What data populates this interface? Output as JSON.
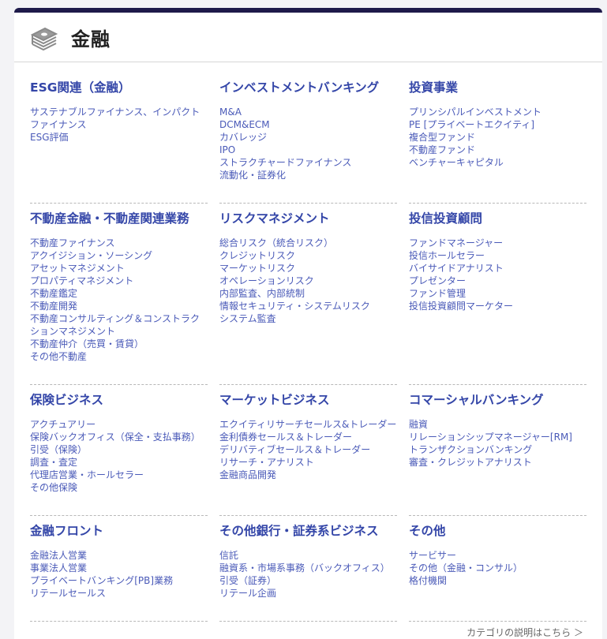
{
  "header": {
    "title": "金融"
  },
  "sections": [
    {
      "title": "ESG関連（金融）",
      "items": [
        "サステナブルファイナンス、インパクトファイナンス",
        "ESG評価"
      ]
    },
    {
      "title": "インベストメントバンキング",
      "items": [
        "M&A",
        "DCM&ECM",
        "カバレッジ",
        "IPO",
        "ストラクチャードファイナンス",
        "流動化・証券化"
      ]
    },
    {
      "title": "投資事業",
      "items": [
        "プリンシパルインベストメント",
        "PE [プライベートエクイティ]",
        "複合型ファンド",
        "不動産ファンド",
        "ベンチャーキャピタル"
      ]
    },
    {
      "title": "不動産金融・不動産関連業務",
      "items": [
        "不動産ファイナンス",
        "アクイジション・ソーシング",
        "アセットマネジメント",
        "プロパティマネジメント",
        "不動産鑑定",
        "不動産開発",
        "不動産コンサルティング＆コンストラクションマネジメント",
        "不動産仲介（売買・賃貸）",
        "その他不動産"
      ]
    },
    {
      "title": "リスクマネジメント",
      "items": [
        "総合リスク（統合リスク）",
        "クレジットリスク",
        "マーケットリスク",
        "オペレーションリスク",
        "内部監査、内部統制",
        "情報セキュリティ・システムリスク",
        "システム監査"
      ]
    },
    {
      "title": "投信投資顧問",
      "items": [
        "ファンドマネージャー",
        "投信ホールセラー",
        "バイサイドアナリスト",
        "プレゼンター",
        "ファンド管理",
        "投信投資顧問マーケター"
      ]
    },
    {
      "title": "保険ビジネス",
      "items": [
        "アクチュアリー",
        "保険バックオフィス（保全・支払事務）",
        "引受（保険）",
        "調査・査定",
        "代理店営業・ホールセラー",
        "その他保険"
      ]
    },
    {
      "title": "マーケットビジネス",
      "items": [
        "エクイティリサーチセールス&トレーダー",
        "金利債券セールス＆トレーダー",
        "デリバティブセールス＆トレーダー",
        "リサーチ・アナリスト",
        "金融商品開発"
      ]
    },
    {
      "title": "コマーシャルバンキング",
      "items": [
        "融資",
        "リレーションシップマネージャー[RM]",
        "トランザクションバンキング",
        "審査・クレジットアナリスト"
      ]
    },
    {
      "title": "金融フロント",
      "items": [
        "金融法人営業",
        "事業法人営業",
        "プライベートバンキング[PB]業務",
        "リテールセールス"
      ]
    },
    {
      "title": "その他銀行・証券系ビジネス",
      "items": [
        "信託",
        "融資系・市場系事務（バックオフィス）",
        "引受（証券）",
        "リテール企画"
      ]
    },
    {
      "title": "その他",
      "items": [
        "サービサー",
        "その他（金融・コンサル）",
        "格付機関"
      ]
    }
  ],
  "footer": {
    "link_label": "カテゴリの説明はこちら ＞"
  },
  "icon_name": "money-stack-icon",
  "colors": {
    "accent": "#1e1a4a",
    "link": "#3446a8"
  }
}
